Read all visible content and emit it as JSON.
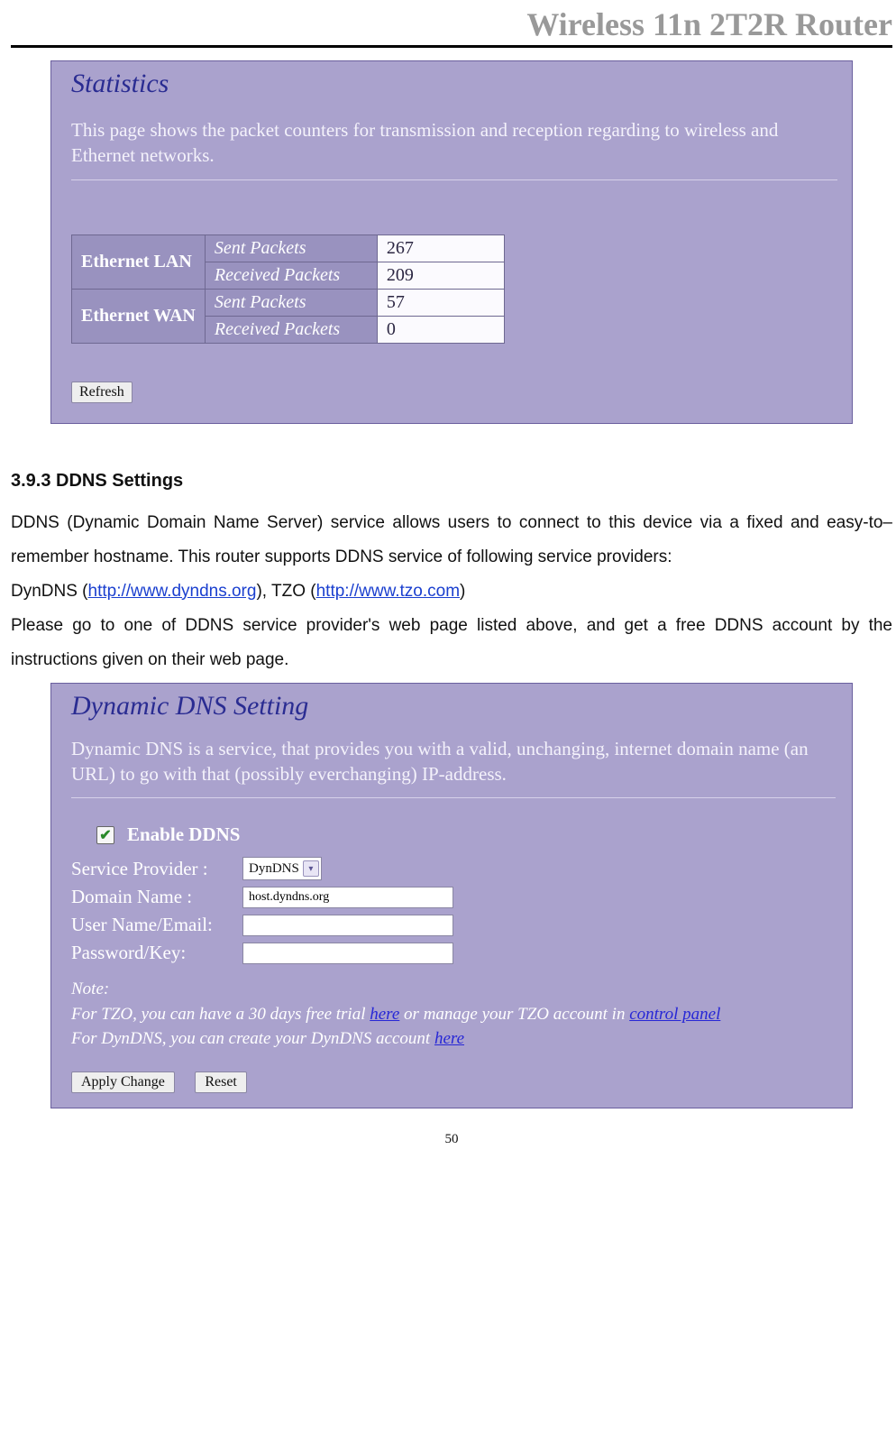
{
  "header": {
    "title": "Wireless 11n 2T2R Router"
  },
  "statistics": {
    "title": "Statistics",
    "description": "This page shows the packet counters for transmission and reception regarding to wireless and Ethernet networks.",
    "rows": [
      {
        "group": "Ethernet LAN",
        "sent_label": "Sent Packets",
        "sent_value": "267",
        "recv_label": "Received Packets",
        "recv_value": "209"
      },
      {
        "group": "Ethernet WAN",
        "sent_label": "Sent Packets",
        "sent_value": "57",
        "recv_label": "Received Packets",
        "recv_value": "0"
      }
    ],
    "refresh_label": "Refresh"
  },
  "section": {
    "heading": "3.9.3   DDNS Settings",
    "p1a": "DDNS (Dynamic Domain Name Server) service allows users to connect to this device via a fixed and easy-to–remember hostname. This router supports DDNS service of following service providers:",
    "p2_pre": "DynDNS (",
    "p2_link1": "http://www.dyndns.org",
    "p2_mid": "), TZO (",
    "p2_link2": "http://www.tzo.com",
    "p2_post": ")",
    "p3": "Please go to one of DDNS service provider's web page listed above, and get a free DDNS account by the instructions given on their web page."
  },
  "ddns": {
    "title": "Dynamic DNS  Setting",
    "description": "Dynamic DNS is a service, that provides you with a valid, unchanging, internet domain name (an URL) to go with that (possibly everchanging) IP-address.",
    "enable_label": "Enable DDNS",
    "labels": {
      "service_provider": "Service Provider :",
      "domain_name": "Domain Name :",
      "user": "User Name/Email:",
      "password": "Password/Key:"
    },
    "values": {
      "service_provider": "DynDNS",
      "domain_name": "host.dyndns.org",
      "user": "",
      "password": ""
    },
    "note_label": "Note:",
    "note_l1a": "For TZO, you can have a 30 days free trial ",
    "note_l1_link1": "here",
    "note_l1b": " or manage your TZO account in ",
    "note_l1_link2": "control panel",
    "note_l2a": "For DynDNS, you can create your DynDNS account ",
    "note_l2_link": "here",
    "apply_label": "Apply Change",
    "reset_label": "Reset"
  },
  "page_number": "50"
}
